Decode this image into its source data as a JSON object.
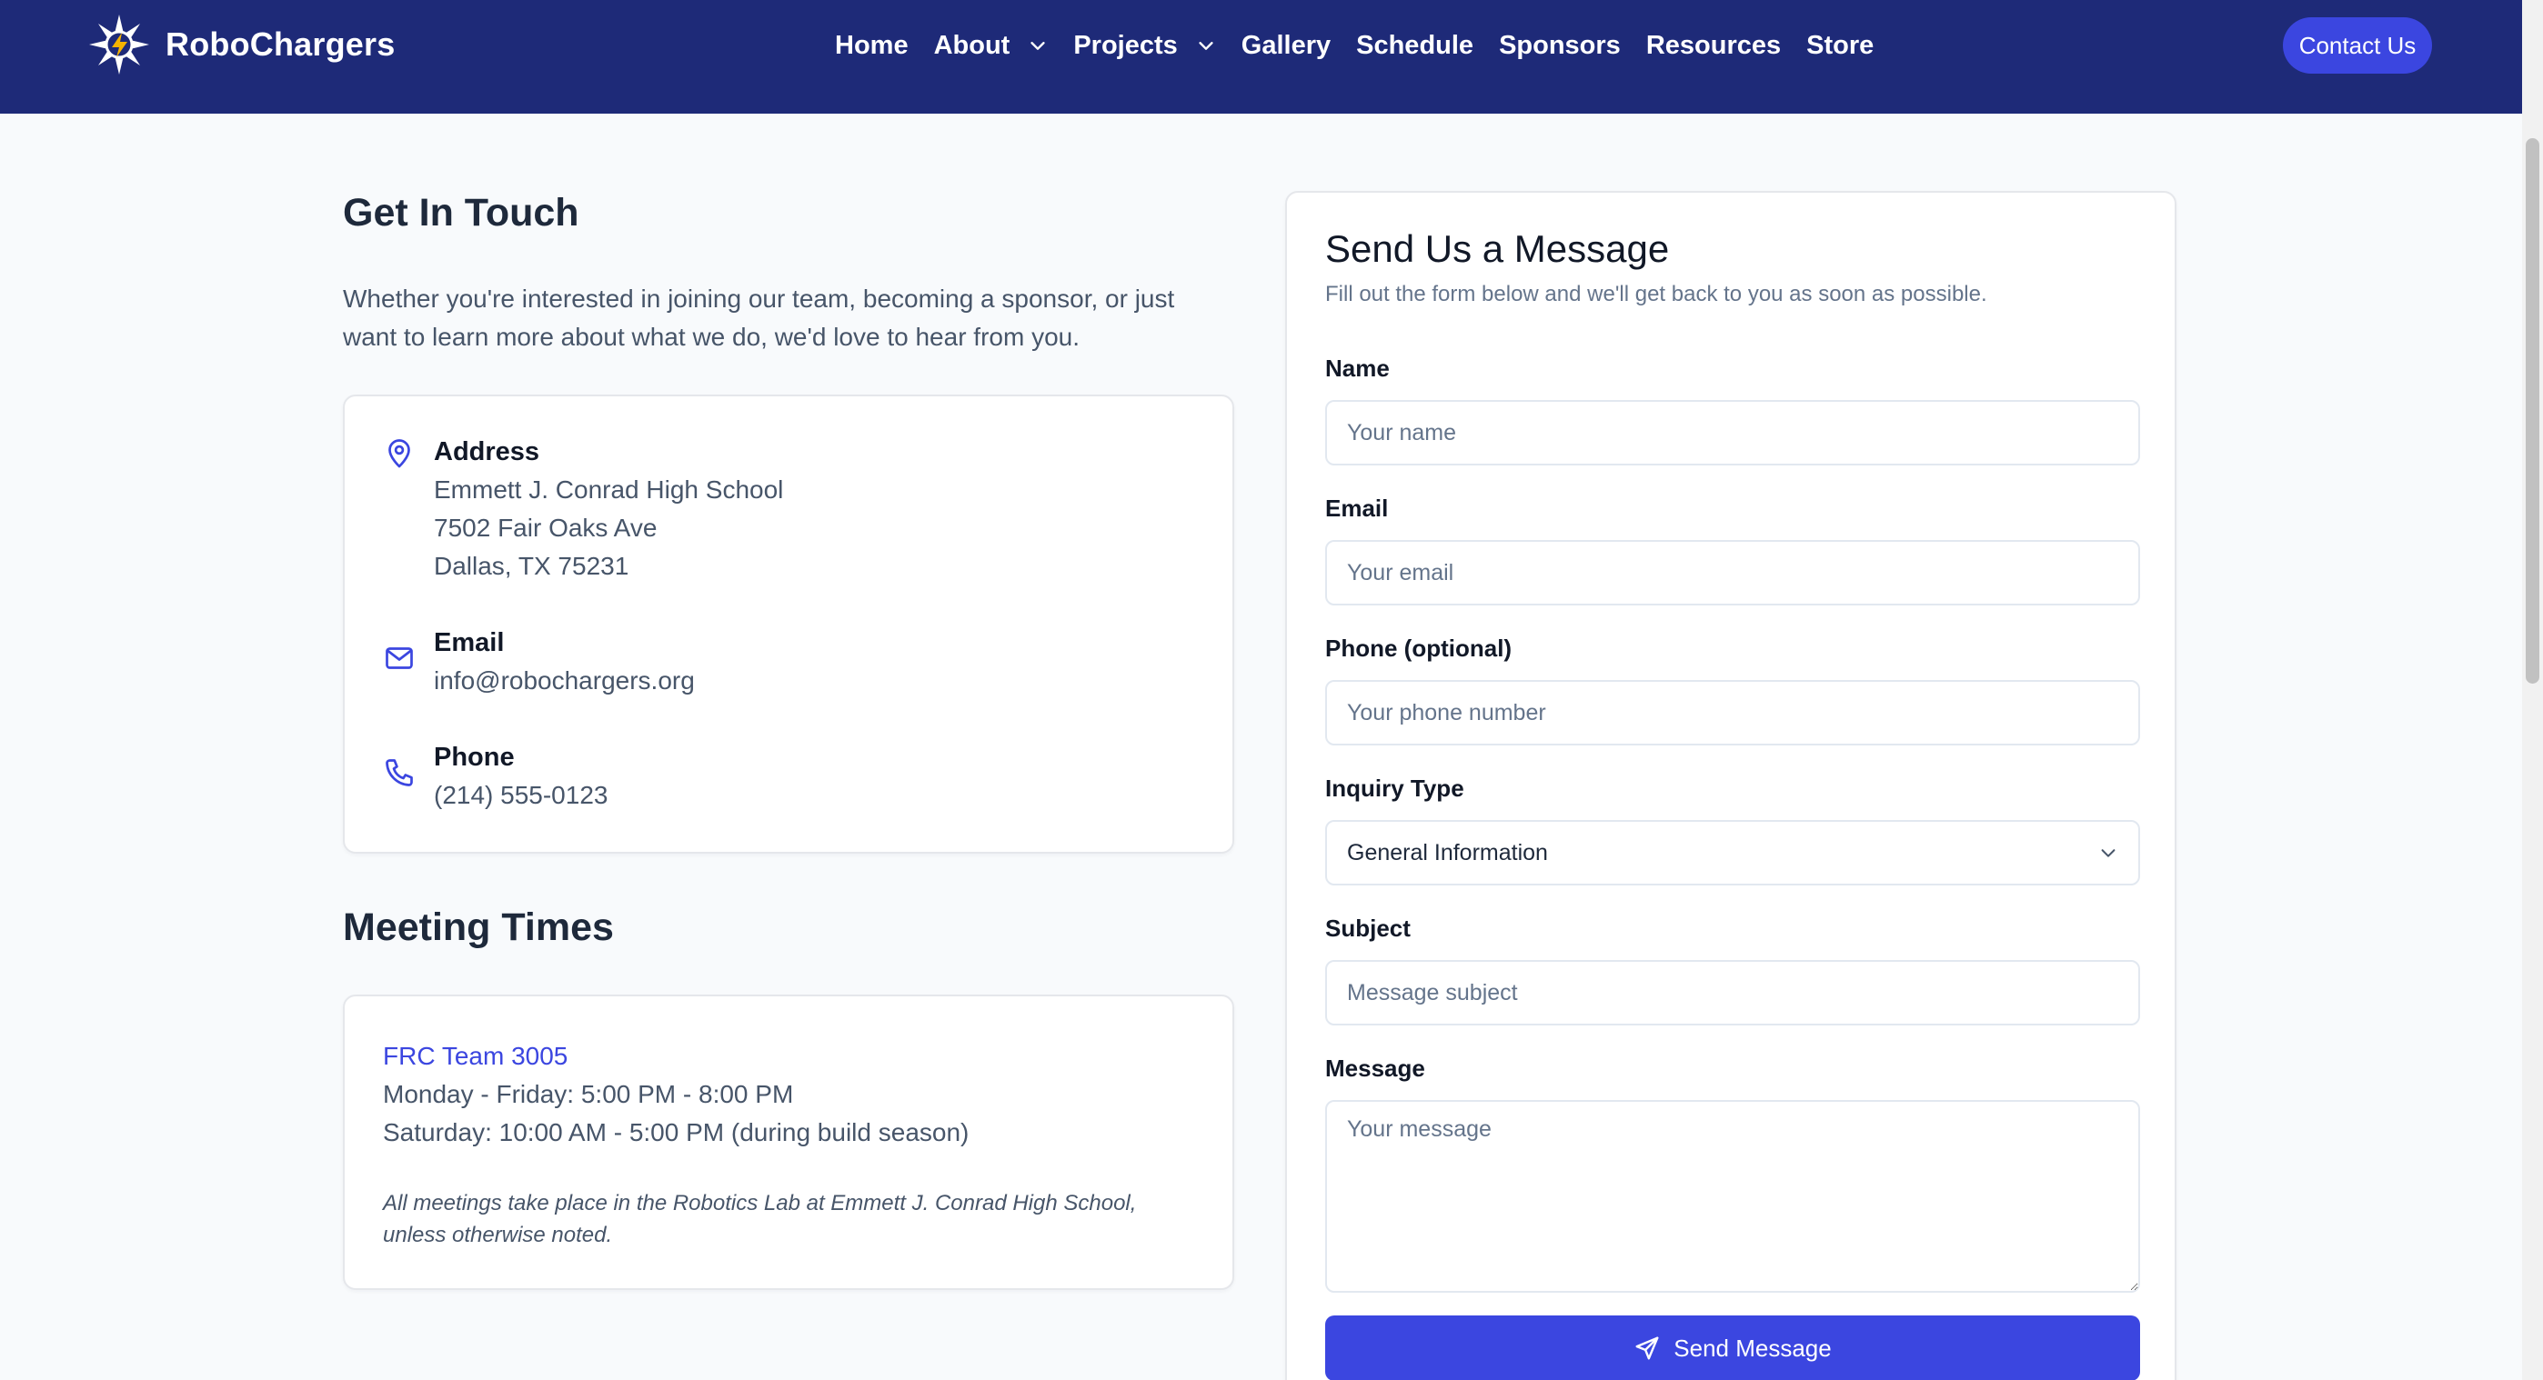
{
  "brand": {
    "name": "RoboChargers"
  },
  "nav": {
    "items": [
      {
        "label": "Home",
        "dropdown": false
      },
      {
        "label": "About",
        "dropdown": true
      },
      {
        "label": "Projects",
        "dropdown": true
      },
      {
        "label": "Gallery",
        "dropdown": false
      },
      {
        "label": "Schedule",
        "dropdown": false
      },
      {
        "label": "Sponsors",
        "dropdown": false
      },
      {
        "label": "Resources",
        "dropdown": false
      },
      {
        "label": "Store",
        "dropdown": false
      }
    ],
    "cta_label": "Contact Us"
  },
  "contact": {
    "title": "Get In Touch",
    "description": "Whether you're interested in joining our team, becoming a sponsor, or just want to learn more about what we do, we'd love to hear from you.",
    "address": {
      "label": "Address",
      "lines": [
        "Emmett J. Conrad High School",
        "7502 Fair Oaks Ave",
        "Dallas, TX 75231"
      ],
      "icon": "map-pin-icon"
    },
    "email": {
      "label": "Email",
      "value": "info@robochargers.org",
      "icon": "mail-icon"
    },
    "phone": {
      "label": "Phone",
      "value": "(214) 555-0123",
      "icon": "phone-icon"
    }
  },
  "meetings": {
    "title": "Meeting Times",
    "team": "FRC Team 3005",
    "lines": [
      "Monday - Friday: 5:00 PM - 8:00 PM",
      "Saturday: 10:00 AM - 5:00 PM (during build season)"
    ],
    "note": "All meetings take place in the Robotics Lab at Emmett J. Conrad High School, unless otherwise noted."
  },
  "form": {
    "title": "Send Us a Message",
    "subtitle": "Fill out the form below and we'll get back to you as soon as possible.",
    "name": {
      "label": "Name",
      "placeholder": "Your name",
      "value": ""
    },
    "email": {
      "label": "Email",
      "placeholder": "Your email",
      "value": ""
    },
    "phone": {
      "label": "Phone (optional)",
      "placeholder": "Your phone number",
      "value": ""
    },
    "inquiry": {
      "label": "Inquiry Type",
      "selected": "General Information"
    },
    "subject": {
      "label": "Subject",
      "placeholder": "Message subject",
      "value": ""
    },
    "message": {
      "label": "Message",
      "placeholder": "Your message",
      "value": ""
    },
    "submit_label": "Send Message"
  },
  "colors": {
    "nav_bg": "#1e2a78",
    "accent": "#3b46e0",
    "page_bg": "#f8fafc",
    "text_muted": "#475569"
  }
}
